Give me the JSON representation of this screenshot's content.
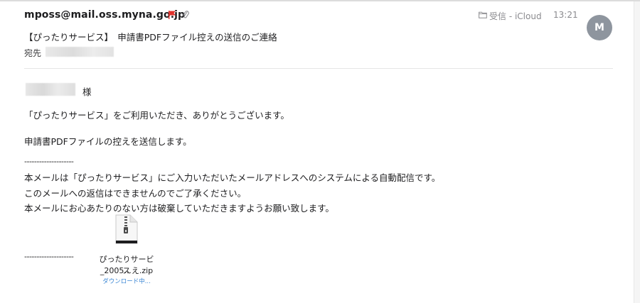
{
  "header": {
    "sender": "mposs@mail.oss.myna.go.jp",
    "mailbox": "受信 - iCloud",
    "time": "13:21",
    "avatar_initial": "M",
    "subject": "【ぴったりサービス】　申請書PDFファイル控えの送信のご連絡",
    "to_label": "宛先",
    "flag_color": "#e0312b"
  },
  "body": {
    "honorific": "様",
    "line1": "「ぴったりサービス」をご利用いただき、ありがとうございます。",
    "line2": "申請書PDFファイルの控えを送信します。",
    "separator_top": "--------------------",
    "note1": "本メールは「ぴったりサービス」にご入力いただいたメールアドレスへのシステムによる自動配信です。",
    "note2": "このメールへの返信はできませんのでご了承ください。",
    "note3": "本メールにお心あたりのない方は破棄していただきますようお願い致します。",
    "separator_bottom": "--------------------"
  },
  "attachment": {
    "name_line1": "ぴったりサービス",
    "name_line2": "_2005...え.zip",
    "status": "ダウンロード中...",
    "icon": "zip-file-icon"
  }
}
